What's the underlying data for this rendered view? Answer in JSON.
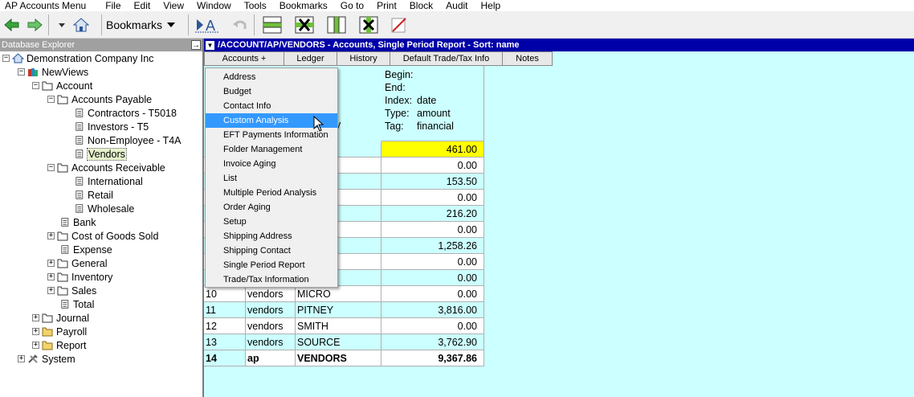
{
  "menubar": {
    "app_title": "AP Accounts Menu",
    "items": [
      "File",
      "Edit",
      "View",
      "Window",
      "Tools",
      "Bookmarks",
      "Go to",
      "Print",
      "Block",
      "Audit",
      "Help"
    ]
  },
  "toolbar": {
    "bookmarks_label": "Bookmarks",
    "icons": [
      "back-icon",
      "forward-icon",
      "home-icon",
      "find-icon",
      "undo-icon",
      "insert-row-icon",
      "delete-row-icon",
      "insert-column-icon",
      "delete-column-icon",
      "erase-icon"
    ]
  },
  "sidebar": {
    "header": "Database Explorer",
    "pin_symbol": "→",
    "tree": [
      {
        "label": "Demonstration Company Inc",
        "expander": "−"
      },
      {
        "label": "NewViews",
        "expander": "−"
      },
      {
        "label": "Account",
        "expander": "−"
      },
      {
        "label": "Accounts Payable",
        "expander": "−"
      },
      {
        "label": "Contractors - T5018"
      },
      {
        "label": "Investors - T5"
      },
      {
        "label": "Non-Employee - T4A"
      },
      {
        "label": "Vendors"
      },
      {
        "label": "Accounts Receivable",
        "expander": "−"
      },
      {
        "label": "International"
      },
      {
        "label": "Retail"
      },
      {
        "label": "Wholesale"
      },
      {
        "label": "Bank"
      },
      {
        "label": "Cost of Goods Sold",
        "expander": "+"
      },
      {
        "label": "Expense"
      },
      {
        "label": "General",
        "expander": "+"
      },
      {
        "label": "Inventory",
        "expander": "+"
      },
      {
        "label": "Sales",
        "expander": "+"
      },
      {
        "label": "Total"
      },
      {
        "label": "Journal",
        "expander": "+"
      },
      {
        "label": "Payroll",
        "expander": "+"
      },
      {
        "label": "Report",
        "expander": "+"
      },
      {
        "label": "System",
        "expander": "+"
      }
    ]
  },
  "main": {
    "title": "/ACCOUNT/AP/VENDORS - Accounts, Single Period Report - Sort: name",
    "tabs": [
      "Accounts    +",
      "Ledger",
      "History",
      "Default Trade/Tax Info",
      "Notes"
    ],
    "header_info": [
      {
        "key": "Begin:",
        "val": ""
      },
      {
        "key": "End:",
        "val": ""
      },
      {
        "key": "Index:",
        "val": "date"
      },
      {
        "key": "Type:",
        "val": "amount"
      },
      {
        "key": "Tag:",
        "val": "financial"
      }
    ],
    "header_fragment": "y",
    "rows": [
      {
        "n": "",
        "type": "",
        "name": "AGE",
        "amount": "461.00"
      },
      {
        "n": "",
        "type": "",
        "name": "DER",
        "amount": "0.00"
      },
      {
        "n": "",
        "type": "",
        "name": "D",
        "amount": "153.50"
      },
      {
        "n": "",
        "type": "",
        "name": "E",
        "amount": "0.00"
      },
      {
        "n": "",
        "type": "",
        "name": "S",
        "amount": "216.20"
      },
      {
        "n": "",
        "type": "",
        "name": "DE",
        "amount": "0.00"
      },
      {
        "n": "",
        "type": "",
        "name": "RISE",
        "amount": "1,258.26"
      },
      {
        "n": "",
        "type": "",
        "name": "",
        "amount": "0.00"
      },
      {
        "n": "",
        "type": "",
        "name": "",
        "amount": "0.00"
      },
      {
        "n": "10",
        "type": "vendors",
        "name": "MICRO",
        "amount": "0.00"
      },
      {
        "n": "11",
        "type": "vendors",
        "name": "PITNEY",
        "amount": "3,816.00"
      },
      {
        "n": "12",
        "type": "vendors",
        "name": "SMITH",
        "amount": "0.00"
      },
      {
        "n": "13",
        "type": "vendors",
        "name": "SOURCE",
        "amount": "3,762.90"
      },
      {
        "n": "14",
        "type": "ap",
        "name": "VENDORS",
        "amount": "9,367.86"
      }
    ]
  },
  "dropdown": {
    "items": [
      "Address",
      "Budget",
      "Contact Info",
      "Custom Analysis",
      "EFT Payments Information",
      "Folder Management",
      "Invoice Aging",
      "List",
      "Multiple Period Analysis",
      "Order Aging",
      "Setup",
      "Shipping Address",
      "Shipping Contact",
      "Single Period Report",
      "Trade/Tax Information"
    ],
    "active": "Custom Analysis"
  }
}
